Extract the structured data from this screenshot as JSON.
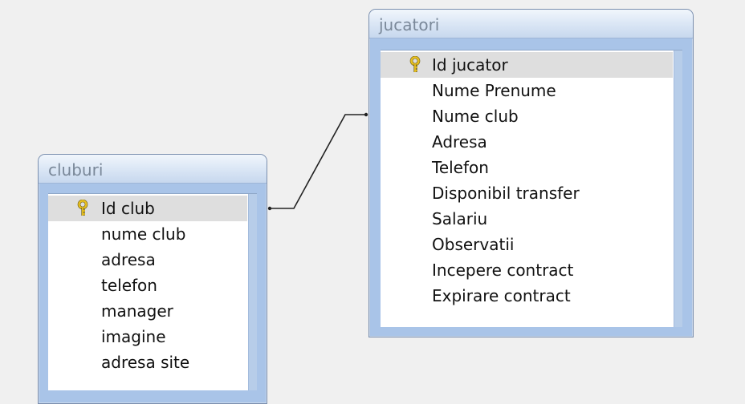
{
  "tables": {
    "cluburi": {
      "title": "cluburi",
      "fields": [
        {
          "label": "Id club",
          "primary_key": true
        },
        {
          "label": "nume club"
        },
        {
          "label": "adresa"
        },
        {
          "label": "telefon"
        },
        {
          "label": "manager"
        },
        {
          "label": "imagine"
        },
        {
          "label": "adresa site"
        }
      ]
    },
    "jucatori": {
      "title": "jucatori",
      "fields": [
        {
          "label": "Id jucator",
          "primary_key": true
        },
        {
          "label": "Nume Prenume"
        },
        {
          "label": "Nume club"
        },
        {
          "label": "Adresa"
        },
        {
          "label": "Telefon"
        },
        {
          "label": "Disponibil transfer"
        },
        {
          "label": "Salariu"
        },
        {
          "label": "Observatii"
        },
        {
          "label": "Incepere contract"
        },
        {
          "label": "Expirare contract"
        }
      ]
    }
  },
  "relationship": {
    "from": "cluburi",
    "to": "jucatori"
  },
  "colors": {
    "background": "#f0f0f0",
    "window_frame": "#a9c4e8",
    "title_text": "#7a8899",
    "field_text": "#111111",
    "selected_row": "#dedede",
    "key_icon": "#e8c020"
  }
}
